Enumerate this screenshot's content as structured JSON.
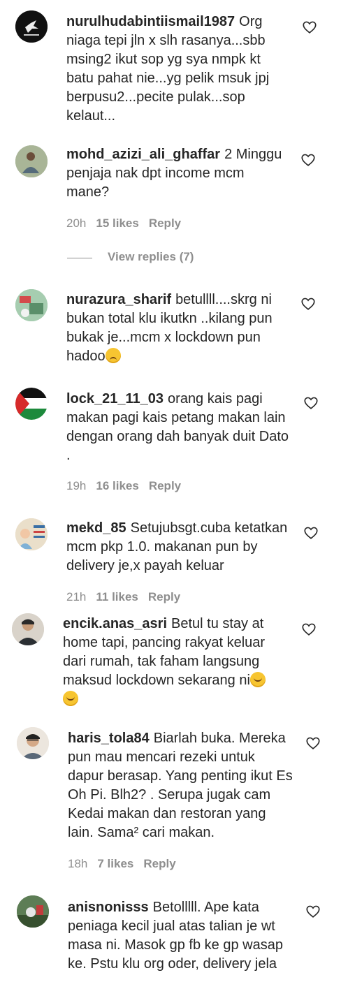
{
  "comments": [
    {
      "username": "nurulhudabintiismail1987",
      "text": "Org niaga tepi jln x slh rasanya...sbb msing2 ikut sop yg sya nmpk kt batu pahat nie...yg pelik msuk jpj berpusu2...pecite pulak...sop kelaut...",
      "avatar_color": "#1a1a1a"
    },
    {
      "username": "mohd_azizi_ali_ghaffar",
      "text": "2 Minggu penjaja nak dpt income mcm mane?",
      "time": "20h",
      "likes": "15 likes",
      "reply": "Reply",
      "avatar_color": "#7a8a6a"
    },
    {
      "username": "nurazura_sharif",
      "text": "betullll....skrg ni bukan total klu ikutkn ..kilang pun bukak je...mcm x lockdown pun hadoo",
      "avatar_color": "#8fb59a"
    },
    {
      "username": "lock_21_11_03",
      "text": "orang kais pagi makan pagi kais petang makan lain dengan orang dah banyak duit Dato .",
      "time": "19h",
      "likes": "16 likes",
      "reply": "Reply",
      "avatar_color": "#2c7a3a"
    },
    {
      "username": "mekd_85",
      "text": "Setujubsgt.cuba ketatkan mcm pkp 1.0. makanan pun by delivery je,x payah keluar",
      "time": "21h",
      "likes": "11 likes",
      "reply": "Reply",
      "avatar_color": "#d9cbb0"
    },
    {
      "username": "encik.anas_asri",
      "text": "Betul tu stay at home tapi, pancing rakyat keluar dari rumah, tak faham langsung maksud lockdown sekarang ni",
      "avatar_color": "#5b4a3d"
    },
    {
      "username": "haris_tola84",
      "text": "Biarlah buka. Mereka pun mau mencari rezeki untuk dapur berasap. Yang penting ikut Es Oh Pi. Blh2? . Serupa jugak cam Kedai makan dan restoran yang lain. Sama² cari makan.",
      "time": "18h",
      "likes": "7 likes",
      "reply": "Reply",
      "avatar_color": "#c9a68a"
    },
    {
      "username": "anisnonisss",
      "text": "Betolllll. Ape kata peniaga kecil jual atas talian je wt masa ni. Masok gp fb ke gp wasap ke. Pstu klu org oder, delivery jela",
      "avatar_color": "#3d5a3a"
    }
  ],
  "view_replies": "View replies (7)",
  "icons": {
    "like": "heart-outline-icon",
    "emoji_pensive": "pensive-face-icon",
    "emoji_laugh": "rolling-laughing-face-icon"
  }
}
